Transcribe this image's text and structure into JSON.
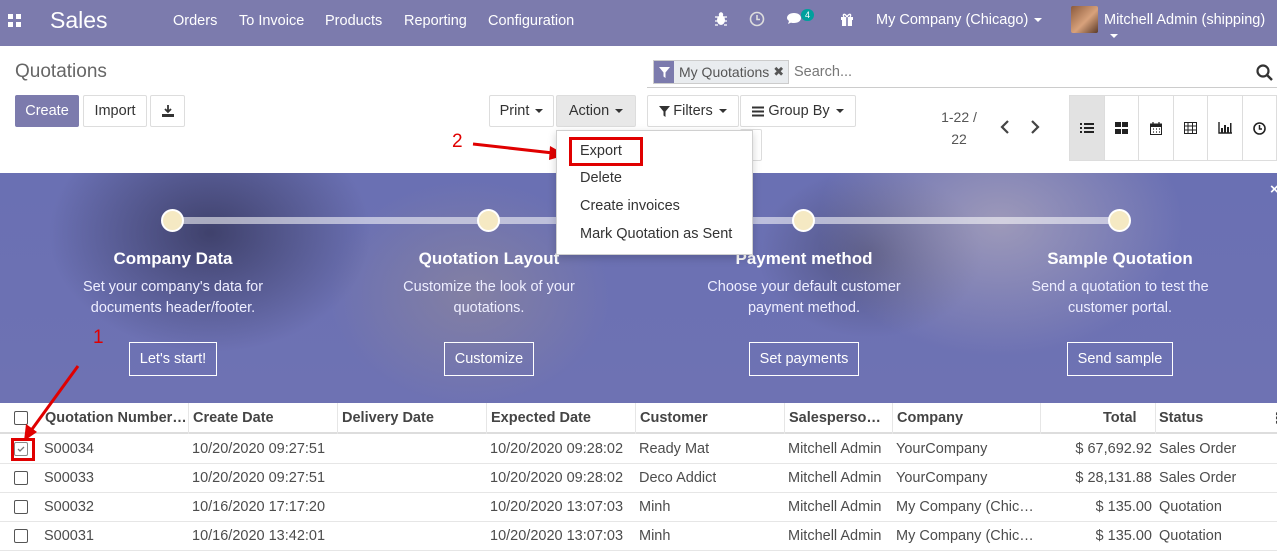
{
  "navbar": {
    "app": "Sales",
    "menus": [
      "Orders",
      "To Invoice",
      "Products",
      "Reporting",
      "Configuration"
    ],
    "messages_count": "4",
    "company": "My Company (Chicago)",
    "user": "Mitchell Admin (shipping)"
  },
  "control": {
    "title": "Quotations",
    "create": "Create",
    "import": "Import",
    "print": "Print",
    "action": "Action",
    "filters": "Filters",
    "group_by": "Group By",
    "facet": "My Quotations",
    "search_placeholder": "Search...",
    "pager_range": "1-22 /",
    "pager_total": "22"
  },
  "action_menu": {
    "items": [
      "Export",
      "Delete",
      "Create invoices",
      "Mark Quotation as Sent"
    ]
  },
  "annotations": {
    "one": "1",
    "two": "2"
  },
  "onboarding": {
    "steps": [
      {
        "title": "Company Data",
        "desc1": "Set your company's data for",
        "desc2": "documents header/footer.",
        "button": "Let's start!"
      },
      {
        "title": "Quotation Layout",
        "desc1": "Customize the look of your",
        "desc2": "quotations.",
        "button": "Customize"
      },
      {
        "title": "Payment method",
        "desc1": "Choose your default customer",
        "desc2": "payment method.",
        "button": "Set payments"
      },
      {
        "title": "Sample Quotation",
        "desc1": "Send a quotation to test the",
        "desc2": "customer portal.",
        "button": "Send sample"
      }
    ]
  },
  "table": {
    "headers": [
      "Quotation Number…",
      "Create Date",
      "Delivery Date",
      "Expected Date",
      "Customer",
      "Salesperso…",
      "Company",
      "Total",
      "Status"
    ],
    "rows": [
      {
        "number": "S00034",
        "create": "10/20/2020 09:27:51",
        "delivery": "",
        "expected": "10/20/2020 09:28:02",
        "customer": "Ready Mat",
        "salesperson": "Mitchell Admin",
        "company": "YourCompany",
        "total": "$ 67,692.92",
        "status": "Sales Order",
        "checked": true
      },
      {
        "number": "S00033",
        "create": "10/20/2020 09:27:51",
        "delivery": "",
        "expected": "10/20/2020 09:28:02",
        "customer": "Deco Addict",
        "salesperson": "Mitchell Admin",
        "company": "YourCompany",
        "total": "$ 28,131.88",
        "status": "Sales Order",
        "checked": false
      },
      {
        "number": "S00032",
        "create": "10/16/2020 17:17:20",
        "delivery": "",
        "expected": "10/20/2020 13:07:03",
        "customer": "Minh",
        "salesperson": "Mitchell Admin",
        "company": "My Company (Chic…",
        "total": "$ 135.00",
        "status": "Quotation",
        "checked": false
      },
      {
        "number": "S00031",
        "create": "10/16/2020 13:42:01",
        "delivery": "",
        "expected": "10/20/2020 13:07:03",
        "customer": "Minh",
        "salesperson": "Mitchell Admin",
        "company": "My Company (Chic…",
        "total": "$ 135.00",
        "status": "Quotation",
        "checked": false
      }
    ]
  },
  "colors": {
    "brand": "#7c7bad",
    "annotation": "#e00000"
  }
}
